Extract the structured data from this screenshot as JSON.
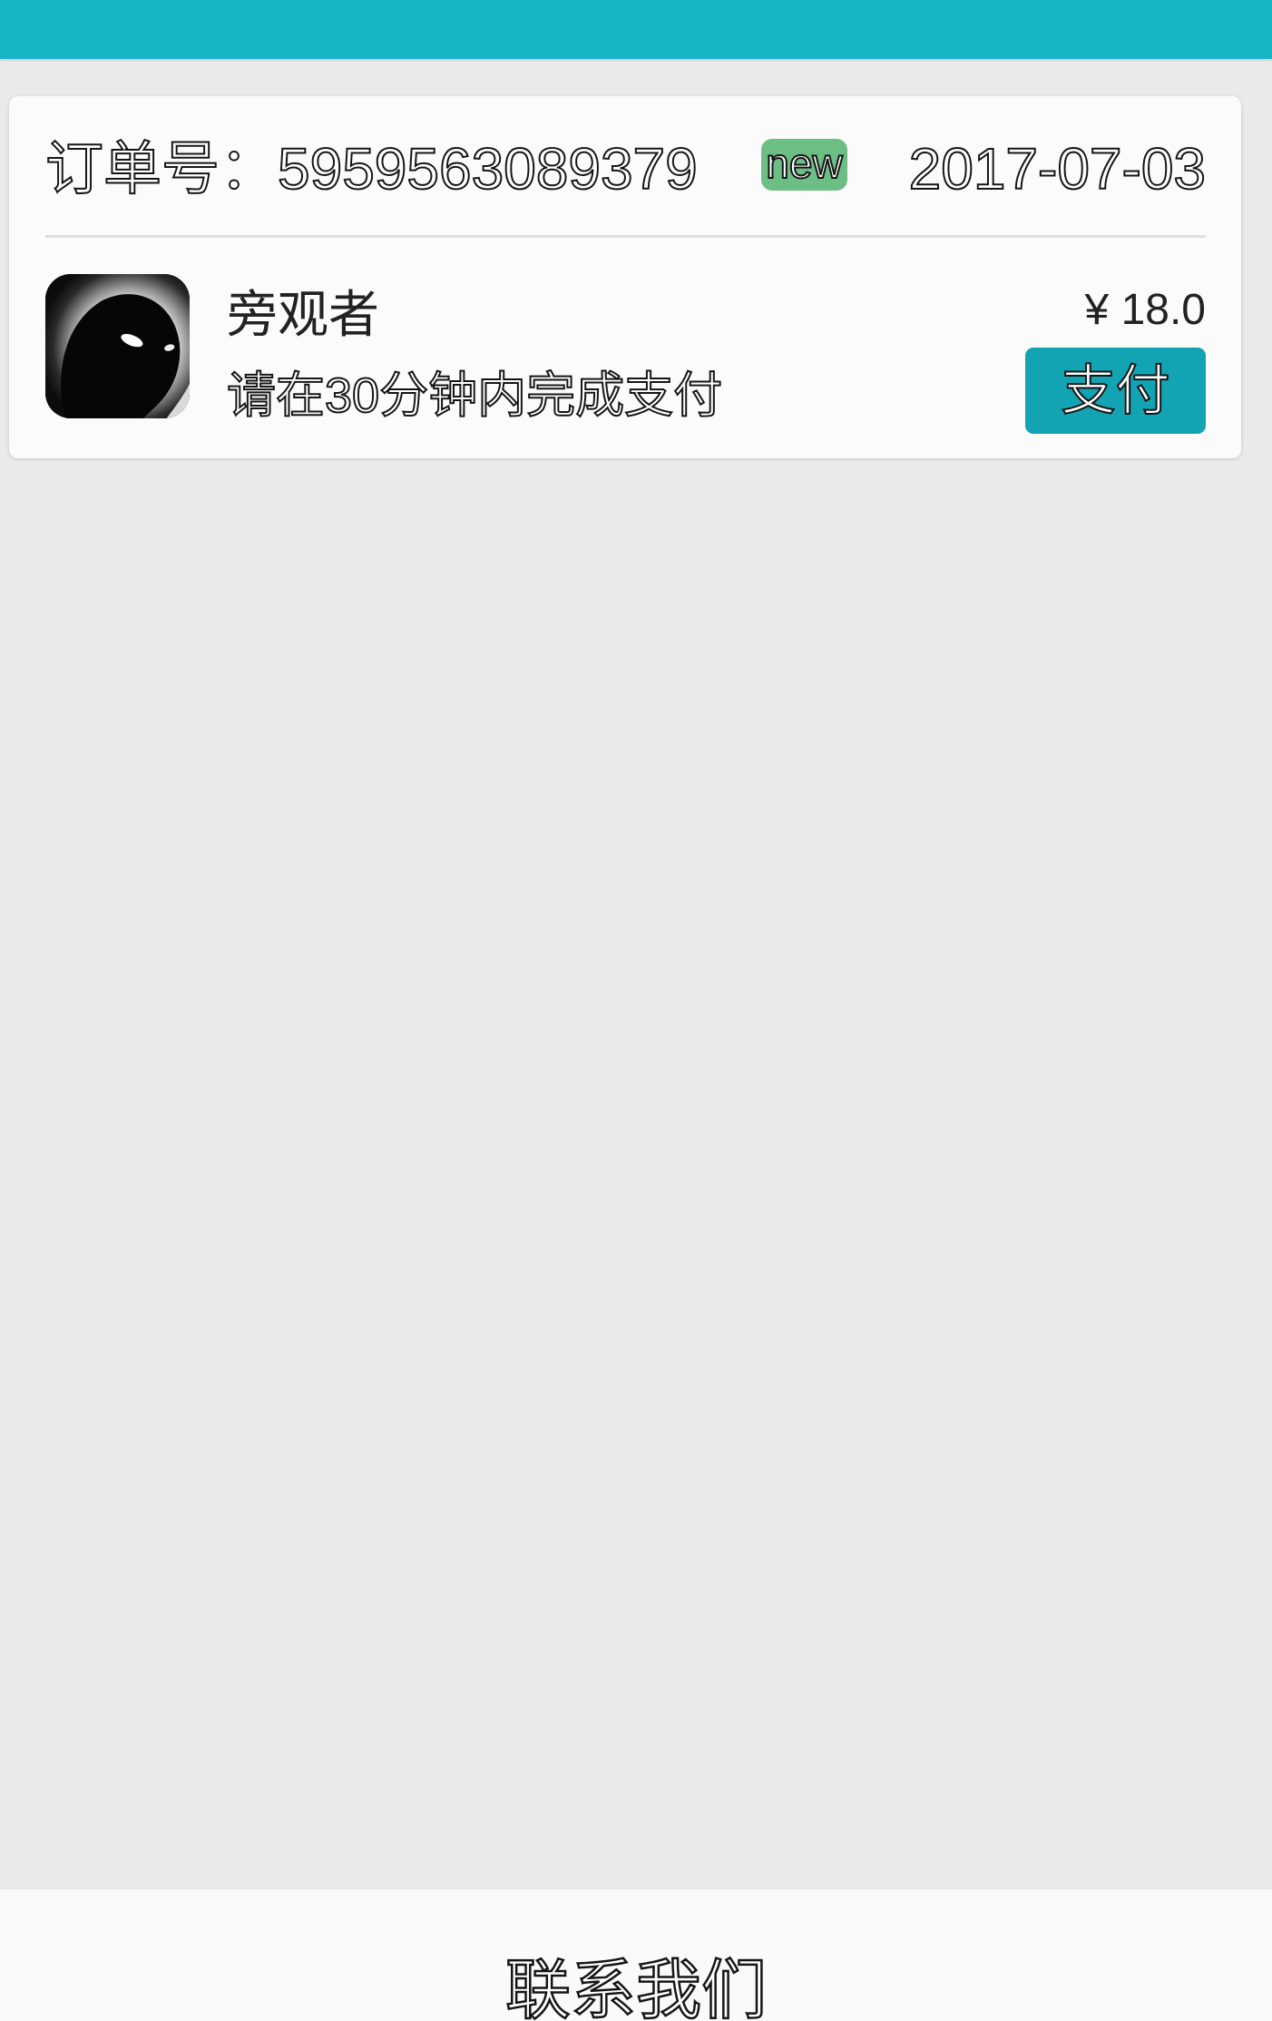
{
  "colors": {
    "accent": "#16b6c6",
    "button": "#13a4b4",
    "badge": "#6cbf84",
    "background": "#eaeaea"
  },
  "order": {
    "label": "订单号：",
    "number": "5959563089379",
    "badge": "new",
    "date": "2017-07-03",
    "item": {
      "icon": "game-cover-icon",
      "name": "旁观者",
      "hint": "请在30分钟内完成支付",
      "price": "¥ 18.0"
    },
    "pay_label": "支付"
  },
  "footer": {
    "contact_label": "联系我们"
  }
}
